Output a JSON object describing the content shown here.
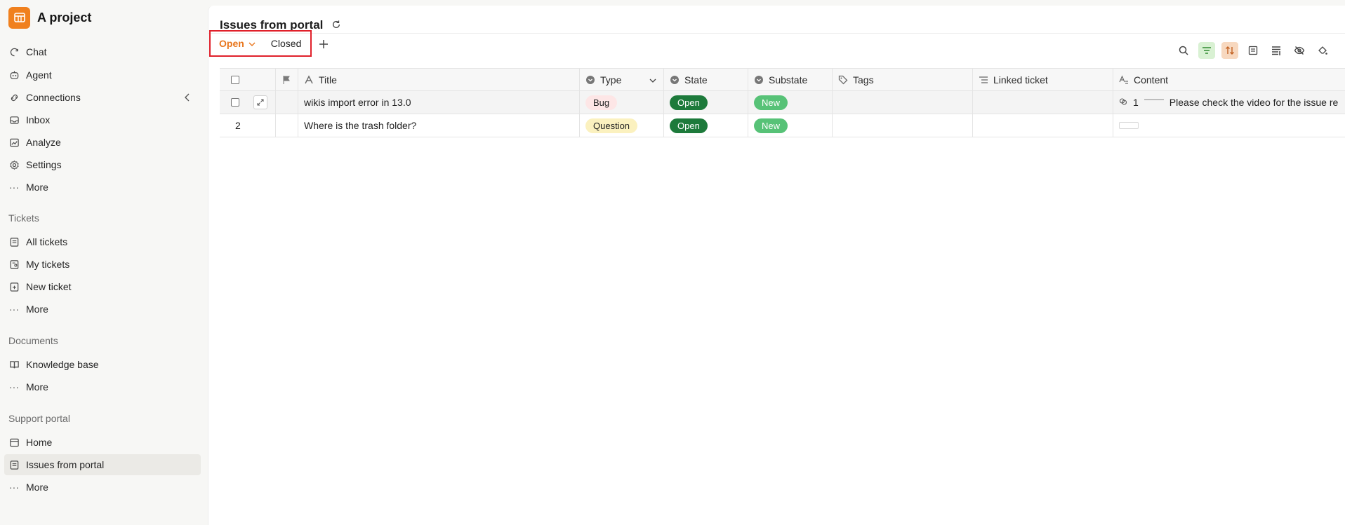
{
  "project": {
    "name": "A project",
    "brand_color": "#f0801e"
  },
  "sidebar": {
    "main_items": [
      {
        "label": "Chat",
        "icon": "chat-icon"
      },
      {
        "label": "Agent",
        "icon": "agent-icon"
      },
      {
        "label": "Connections",
        "icon": "connections-icon"
      },
      {
        "label": "Inbox",
        "icon": "inbox-icon"
      },
      {
        "label": "Analyze",
        "icon": "analyze-icon"
      },
      {
        "label": "Settings",
        "icon": "gear-icon"
      },
      {
        "label": "More",
        "icon": "more-icon"
      }
    ],
    "tickets": {
      "title": "Tickets",
      "items": [
        {
          "label": "All tickets"
        },
        {
          "label": "My tickets"
        },
        {
          "label": "New ticket"
        },
        {
          "label": "More"
        }
      ]
    },
    "documents": {
      "title": "Documents",
      "items": [
        {
          "label": "Knowledge base"
        },
        {
          "label": "More"
        }
      ]
    },
    "support_portal": {
      "title": "Support portal",
      "items": [
        {
          "label": "Home"
        },
        {
          "label": "Issues from portal",
          "active": true
        },
        {
          "label": "More"
        }
      ]
    }
  },
  "header": {
    "title": "Issues from portal"
  },
  "views": {
    "open": "Open",
    "closed": "Closed",
    "accent": "#e8761d"
  },
  "table": {
    "columns": {
      "title": "Title",
      "type": "Type",
      "state": "State",
      "substate": "Substate",
      "tags": "Tags",
      "linked": "Linked ticket",
      "content": "Content"
    },
    "rows": [
      {
        "num": "",
        "title": "wikis import error in 13.0",
        "type": "Bug",
        "state": "Open",
        "substate": "New",
        "content_count": "1",
        "content": "Please check the video for the issue re"
      },
      {
        "num": "2",
        "title": "Where is the trash folder?",
        "type": "Question",
        "state": "Open",
        "substate": "New",
        "content_count": "",
        "content": ""
      }
    ]
  }
}
